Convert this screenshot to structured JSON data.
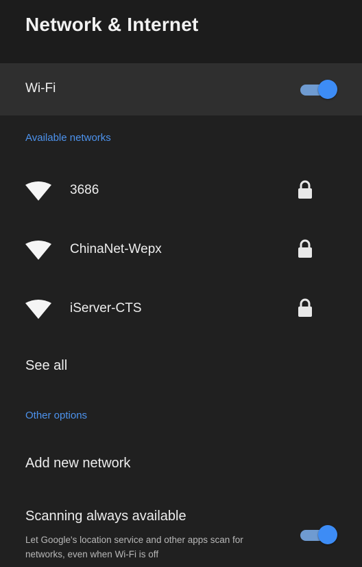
{
  "header": {
    "title": "Network & Internet"
  },
  "wifi": {
    "label": "Wi-Fi",
    "enabled": true
  },
  "available": {
    "section_label": "Available networks",
    "networks": [
      {
        "name": "3686",
        "secured": true,
        "signal_icon": "wifi-full-icon"
      },
      {
        "name": "ChinaNet-Wepx",
        "secured": true,
        "signal_icon": "wifi-full-icon"
      },
      {
        "name": "iServer-CTS",
        "secured": true,
        "signal_icon": "wifi-full-icon"
      }
    ],
    "see_all_label": "See all"
  },
  "other": {
    "section_label": "Other options",
    "add_network_label": "Add new network",
    "scanning": {
      "title": "Scanning always available",
      "description": "Let Google's location service and other apps scan for networks, even when Wi-Fi is off",
      "enabled": true
    }
  },
  "colors": {
    "accent": "#4d93ee",
    "toggle_thumb": "#3d8cf5",
    "toggle_track": "#6f9bd1",
    "background": "#202020",
    "header_bg": "#1c1c1c",
    "highlight_row_bg": "#2f2f2f"
  }
}
